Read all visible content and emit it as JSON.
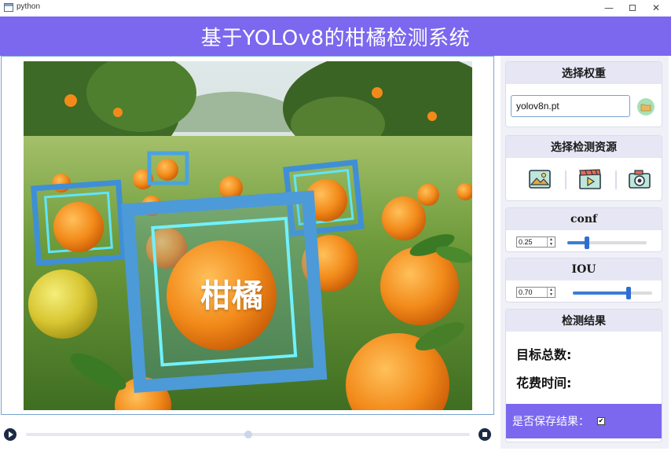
{
  "window": {
    "title": "python",
    "minimize_glyph": "—",
    "close_glyph": "✕"
  },
  "header": {
    "title": "基于YOLOv8的柑橘检测系统",
    "background": "#7b68ee"
  },
  "image": {
    "overlay_text": "柑橘"
  },
  "weights": {
    "heading": "选择权重",
    "file_value": "yolov8n.pt"
  },
  "source": {
    "heading": "选择检测资源",
    "icons": [
      "image-icon",
      "video-icon",
      "camera-icon"
    ]
  },
  "conf": {
    "heading": "conf",
    "value": "0.25",
    "slider_level": 0.25
  },
  "iou": {
    "heading": "IOU",
    "value": "0.70",
    "slider_level": 0.7
  },
  "results": {
    "heading": "检测结果",
    "total_label": "目标总数:",
    "time_label": "花费时间:",
    "save_label": "是否保存结果：",
    "save_checked": true,
    "check_glyph": "✔"
  },
  "player": {
    "progress": 0.5
  }
}
